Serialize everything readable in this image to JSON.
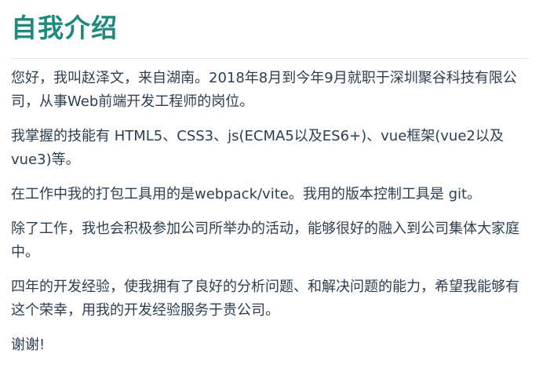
{
  "document": {
    "title": "自我介绍",
    "paragraphs": [
      "您好，我叫赵泽文，来自湖南。2018年8月到今年9月就职于深圳聚谷科技有限公司，从事Web前端开发工程师的岗位。",
      "我掌握的技能有 HTML5、CSS3、js(ECMA5以及ES6+)、vue框架(vue2以及vue3)等。",
      "在工作中我的打包工具用的是webpack/vite。我用的版本控制工具是 git。",
      "除了工作，我也会积极参加公司所举办的活动，能够很好的融入到公司集体大家庭中。",
      "四年的开发经验，使我拥有了良好的分析问题、和解决问题的能力，希望我能够有这个荣幸，用我的开发经验服务于贵公司。",
      "谢谢!"
    ]
  },
  "colors": {
    "title": "#1e8a7e",
    "text": "#2c3e50",
    "divider": "#e3e6ea"
  }
}
